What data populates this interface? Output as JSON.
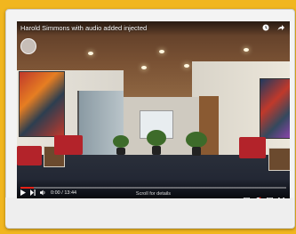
{
  "video": {
    "title": "Harold Simmons with audio added injected",
    "current_time": "0:00",
    "duration": "13:44",
    "time_sep": " / ",
    "scroll_hint": "Scroll for details",
    "progress": 0.05
  },
  "colors": {
    "background": "#f1b61f",
    "progress": "#e62117"
  },
  "icons": {
    "play": "play-icon",
    "next": "next-icon",
    "volume": "volume-icon",
    "watch_later": "clock-icon",
    "share": "share-icon",
    "settings": "gear-icon",
    "captions": "captions-icon",
    "fullscreen": "fullscreen-icon"
  }
}
